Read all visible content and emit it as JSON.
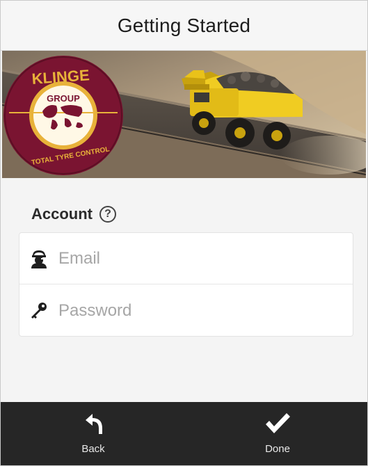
{
  "header": {
    "title": "Getting Started"
  },
  "banner": {
    "logo": {
      "brand": "KLINGE",
      "group": "GROUP",
      "slogan": "TOTAL TYRE CONTROL"
    }
  },
  "account": {
    "heading": "Account",
    "help_icon": "help-circle-icon",
    "email": {
      "placeholder": "Email",
      "value": "",
      "icon": "user-icon"
    },
    "password": {
      "placeholder": "Password",
      "value": "",
      "icon": "key-icon"
    }
  },
  "footer": {
    "back": {
      "label": "Back",
      "icon": "back-arrow-icon"
    },
    "done": {
      "label": "Done",
      "icon": "checkmark-icon"
    }
  },
  "colors": {
    "logo_maroon": "#7a1431",
    "logo_gold": "#e8b23a",
    "truck_yellow": "#e9c21a",
    "footer_bg": "#262626"
  }
}
